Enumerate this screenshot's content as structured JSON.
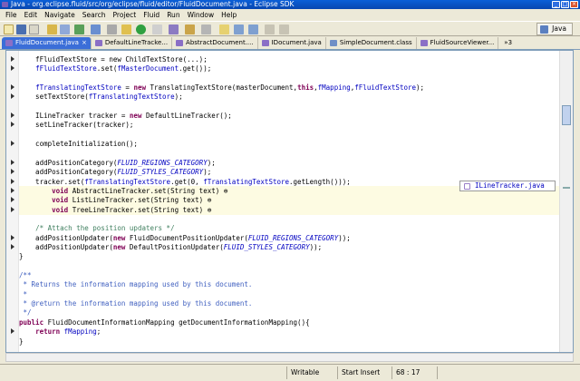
{
  "window": {
    "title": "Java - org.eclipse.fluid/src/org/eclipse/fluid/editor/FluidDocument.java - Eclipse SDK"
  },
  "menu": [
    "File",
    "Edit",
    "Navigate",
    "Search",
    "Project",
    "Fluid",
    "Run",
    "Window",
    "Help"
  ],
  "perspective": {
    "label": "Java"
  },
  "tabs": [
    {
      "label": "FluidDocument.java",
      "active": true,
      "icon_color": "#8a6fc6"
    },
    {
      "label": "DefaultLineTracke...",
      "active": false,
      "icon_color": "#8a6fc6"
    },
    {
      "label": "AbstractDocument....",
      "active": false,
      "icon_color": "#8a6fc6"
    },
    {
      "label": "IDocument.java",
      "active": false,
      "icon_color": "#8a6fc6"
    },
    {
      "label": "SimpleDocument.class",
      "active": false,
      "icon_color": "#6f8fc6"
    },
    {
      "label": "FluidSourceViewer...",
      "active": false,
      "icon_color": "#8a6fc6"
    }
  ],
  "tab_overflow": "»3",
  "code_lines": [
    {
      "html": "    fFluidTextStore = new ChildTextStore(...);",
      "arrow": true
    },
    {
      "html": "    <span class=\"field\">fFluidTextStore</span>.set(<span class=\"field\">fMasterDocument</span>.get());",
      "arrow": true
    },
    {
      "html": "",
      "arrow": false
    },
    {
      "html": "    <span class=\"field\">fTranslatingTextStore</span> = <span class=\"kw\">new</span> TranslatingTextStore(masterDocument,<span class=\"kw\">this</span>,<span class=\"field\">fMapping</span>,<span class=\"field\">fFluidTextStore</span>);",
      "arrow": true
    },
    {
      "html": "    setTextStore(<span class=\"field\">fTranslatingTextStore</span>);",
      "arrow": true
    },
    {
      "html": "",
      "arrow": false
    },
    {
      "html": "    ILineTracker tracker = <span class=\"kw\">new</span> DefaultLineTracker();",
      "arrow": true
    },
    {
      "html": "    setLineTracker(tracker);",
      "arrow": true
    },
    {
      "html": "",
      "arrow": false
    },
    {
      "html": "    completeInitialization();",
      "arrow": true
    },
    {
      "html": "",
      "arrow": false
    },
    {
      "html": "    addPositionCategory(<span class=\"const\">FLUID_REGIONS_CATEGORY</span>);",
      "arrow": true
    },
    {
      "html": "    addPositionCategory(<span class=\"const\">FLUID_STYLES_CATEGORY</span>);",
      "arrow": true
    },
    {
      "html": "    tracker.set(<span class=\"field\">fTranslatingTextStore</span>.get(0, <span class=\"field\">fTranslatingTextStore</span>.getLength()));",
      "arrow": true
    },
    {
      "html": "        <span class=\"kw\">void</span> AbstractLineTracker.set(String text) ⊕",
      "arrow": true,
      "hl": true
    },
    {
      "html": "        <span class=\"kw\">void</span> ListLineTracker.set(String text) ⊕",
      "arrow": true,
      "hl": true
    },
    {
      "html": "        <span class=\"kw\">void</span> TreeLineTracker.set(String text) ⊕",
      "arrow": true,
      "hl": true
    },
    {
      "html": "",
      "arrow": false
    },
    {
      "html": "    <span class=\"cmt2\">/* Attach the position updaters */</span>",
      "arrow": false
    },
    {
      "html": "    addPositionUpdater(<span class=\"kw\">new</span> FluidDocumentPositionUpdater(<span class=\"const\">FLUID_REGIONS_CATEGORY</span>));",
      "arrow": true
    },
    {
      "html": "    addPositionUpdater(<span class=\"kw\">new</span> DefaultPositionUpdater(<span class=\"const\">FLUID_STYLES_CATEGORY</span>));",
      "arrow": true
    },
    {
      "html": "}",
      "arrow": false
    },
    {
      "html": "",
      "arrow": false
    },
    {
      "html": "<span class=\"cmt\">/**</span>",
      "arrow": false
    },
    {
      "html": "<span class=\"cmt\"> * Returns the information mapping used by this document.</span>",
      "arrow": false
    },
    {
      "html": "<span class=\"cmt\"> *</span>",
      "arrow": false
    },
    {
      "html": "<span class=\"cmt\"> * @return the information mapping used by this document.</span>",
      "arrow": false
    },
    {
      "html": "<span class=\"cmt\"> */</span>",
      "arrow": false
    },
    {
      "html": "<span class=\"kw\">public</span> FluidDocumentInformationMapping getDocumentInformationMapping(){",
      "arrow": false
    },
    {
      "html": "    <span class=\"kw\">return</span> <span class=\"field\">fMapping</span>;",
      "arrow": true
    },
    {
      "html": "}",
      "arrow": false
    }
  ],
  "tooltip": {
    "text": "ILineTracker.java"
  },
  "status": {
    "writable": "Writable",
    "insert_mode": "Start Insert",
    "position": "68 : 17"
  }
}
